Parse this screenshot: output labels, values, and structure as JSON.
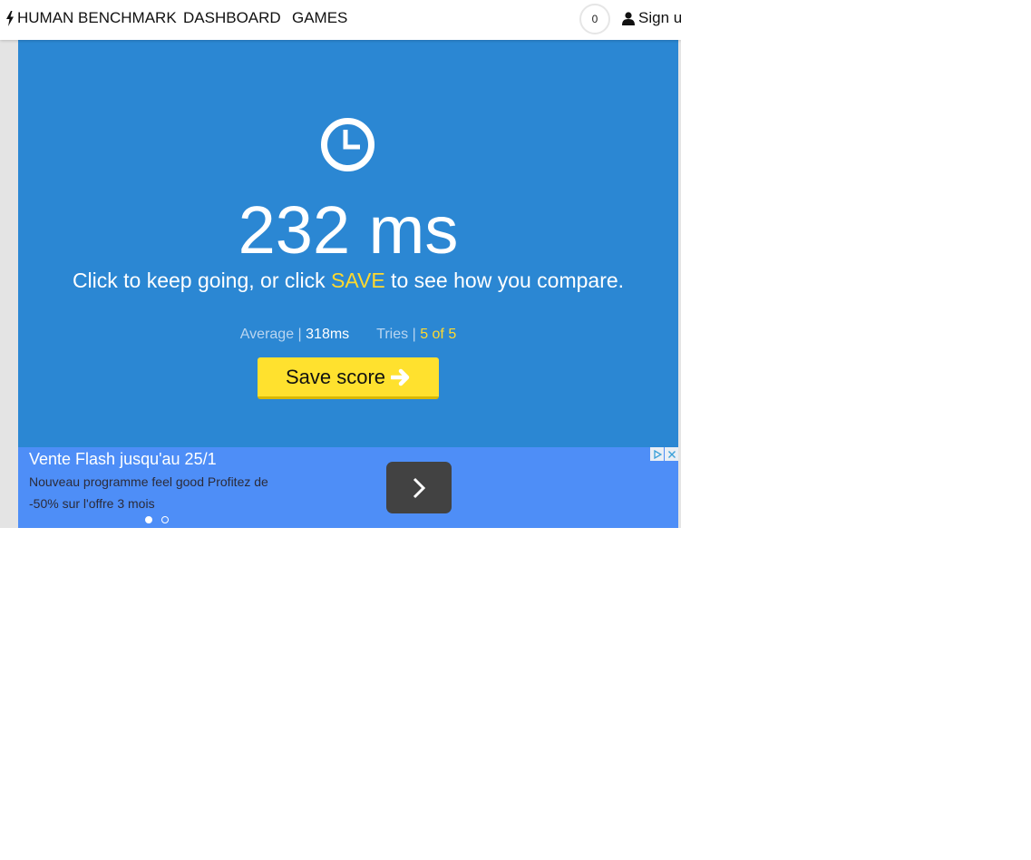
{
  "nav": {
    "brand": "HUMAN BENCHMARK",
    "brand_icon": "bolt-icon",
    "links": [
      "DASHBOARD",
      "GAMES"
    ],
    "badge_count": "0",
    "signup_label": "Sign u",
    "signup_icon": "user-icon"
  },
  "test": {
    "icon": "clock-icon",
    "result": "232 ms",
    "prompt_before": "Click to keep going, or click ",
    "prompt_save": "SAVE",
    "prompt_after": " to see how you compare.",
    "average_label": "Average | ",
    "average_value": "318ms",
    "tries_label": "Tries | ",
    "tries_value": "5 of 5",
    "save_button": "Save score",
    "save_icon": "arrow-right-icon"
  },
  "ad": {
    "title": "Vente Flash jusqu'au 25/1",
    "body": "Nouveau programme feel good Profitez de -50% sur l'offre 3 mois",
    "next_icon": "chevron-right-icon",
    "active_slide": 1,
    "slide_count": 2
  },
  "colors": {
    "test_bg": "#2b87d3",
    "accent_yellow": "#ffd92e",
    "button_yellow": "#ffe12e",
    "ad_bg": "#4e8ef7"
  }
}
